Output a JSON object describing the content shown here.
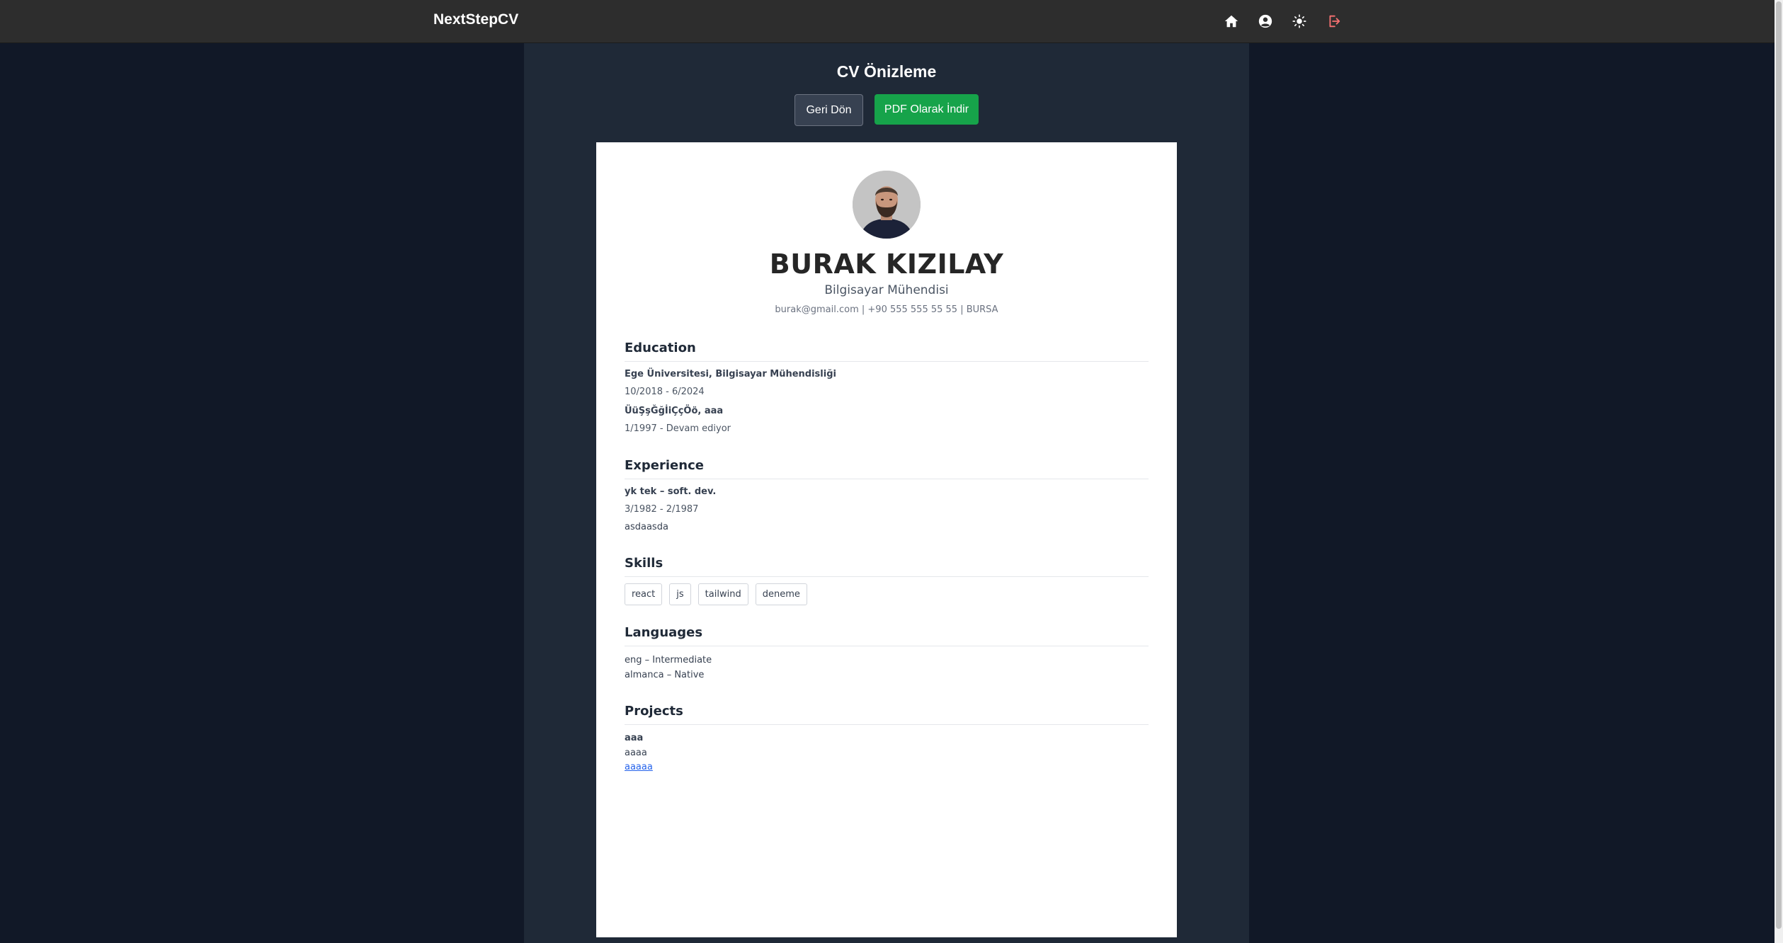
{
  "navbar": {
    "brand": "NextStepCV",
    "icons": [
      "home-icon",
      "user-circle-icon",
      "sun-icon",
      "logout-icon"
    ]
  },
  "page": {
    "title": "CV Önizleme",
    "back_label": "Geri Dön",
    "pdf_label": "PDF Olarak İndir"
  },
  "cv": {
    "name": "BURAK KIZILAY",
    "job_title": "Bilgisayar Mühendisi",
    "contact": "burak@gmail.com | +90 555 555 55 55 | BURSA",
    "education": {
      "title": "Education",
      "items": [
        {
          "school": "Ege Üniversitesi, Bilgisayar Mühendisliği",
          "date": "10/2018 - 6/2024"
        },
        {
          "school": "ÜüŞşĞğİiÇçÖö, aaa",
          "date": "1/1997 - Devam ediyor"
        }
      ]
    },
    "experience": {
      "title": "Experience",
      "items": [
        {
          "role": "yk tek – soft. dev.",
          "date": "3/1982 - 2/1987",
          "desc": "asdaasda"
        }
      ]
    },
    "skills": {
      "title": "Skills",
      "items": [
        "react",
        "js",
        "tailwind",
        "deneme"
      ]
    },
    "languages": {
      "title": "Languages",
      "items": [
        "eng – Intermediate",
        "almanca – Native"
      ]
    },
    "projects": {
      "title": "Projects",
      "items": [
        {
          "name": "aaa",
          "desc": "aaaa",
          "link": "aaaaa"
        }
      ]
    }
  },
  "colors": {
    "background": "#111827",
    "panel": "#1f2937",
    "navbar": "#2d2d2d",
    "accent_green": "#16a34a",
    "logout_red": "#f87171",
    "link_blue": "#2563eb"
  }
}
